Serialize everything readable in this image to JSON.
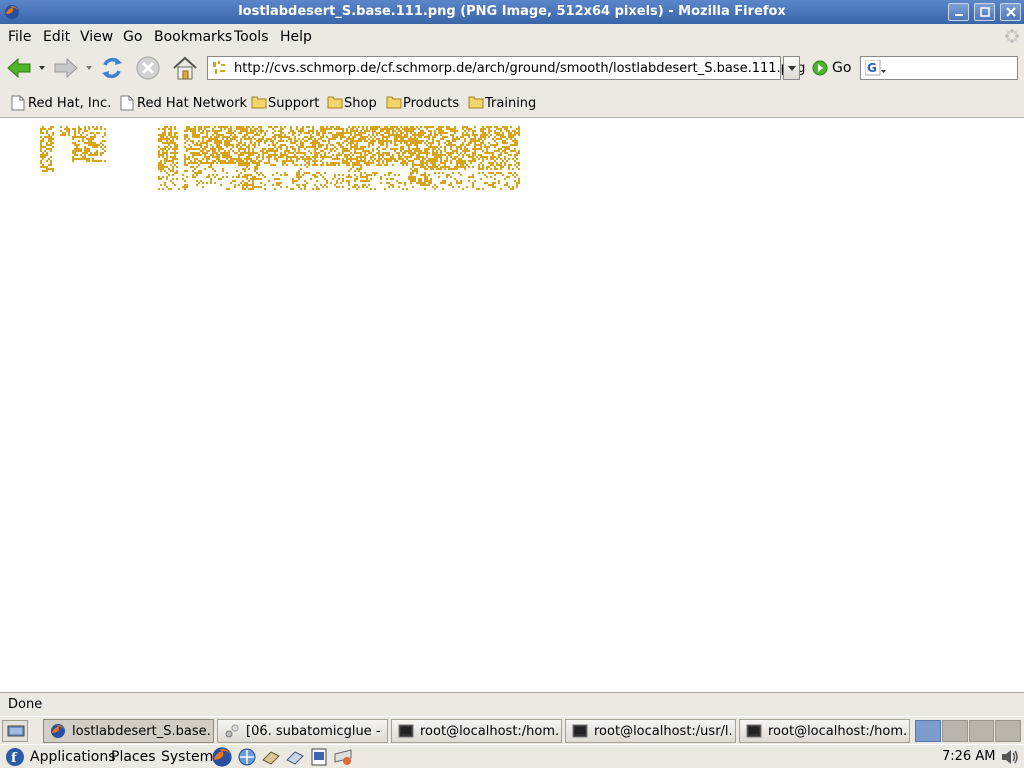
{
  "window": {
    "title": "lostlabdesert_S.base.111.png (PNG Image, 512x64 pixels) - Mozilla Firefox"
  },
  "menu": [
    "File",
    "Edit",
    "View",
    "Go",
    "Bookmarks",
    "Tools",
    "Help"
  ],
  "navigation": {
    "url": "http://cvs.schmorp.de/cf.schmorp.de/arch/ground/smooth/lostlabdesert_S.base.111.png",
    "go_label": "Go",
    "search_value": ""
  },
  "bookmarks": [
    {
      "label": "Red Hat, Inc.",
      "icon": "page-icon"
    },
    {
      "label": "Red Hat Network",
      "icon": "page-icon"
    },
    {
      "label": "Support",
      "icon": "folder-icon"
    },
    {
      "label": "Shop",
      "icon": "folder-icon"
    },
    {
      "label": "Products",
      "icon": "folder-icon"
    },
    {
      "label": "Training",
      "icon": "folder-icon"
    }
  ],
  "content": {
    "image_colors": {
      "sand": "#d8a41a",
      "background": "#ffffff"
    }
  },
  "status": "Done",
  "taskbar": {
    "tasks": [
      {
        "label": "lostlabdesert_S.base...",
        "icon": "firefox-icon",
        "active": true
      },
      {
        "label": "[06. subatomicglue - ...",
        "icon": "media-player-icon",
        "active": false
      },
      {
        "label": "root@localhost:/hom...",
        "icon": "terminal-icon",
        "active": false
      },
      {
        "label": "root@localhost:/usr/l...",
        "icon": "terminal-icon",
        "active": false
      },
      {
        "label": "root@localhost:/hom...",
        "icon": "terminal-icon",
        "active": false
      }
    ]
  },
  "panel": {
    "menus": [
      "Applications",
      "Places",
      "System"
    ],
    "launchers": [
      "firefox-icon",
      "evolution-icon",
      "openoffice-writer-icon",
      "openoffice-impress-icon",
      "openoffice-calc-icon",
      "network-icon"
    ],
    "clock": "7:26 AM"
  },
  "theme": {
    "titlebar": "#4a74b6",
    "accent": "#3a64a8"
  }
}
